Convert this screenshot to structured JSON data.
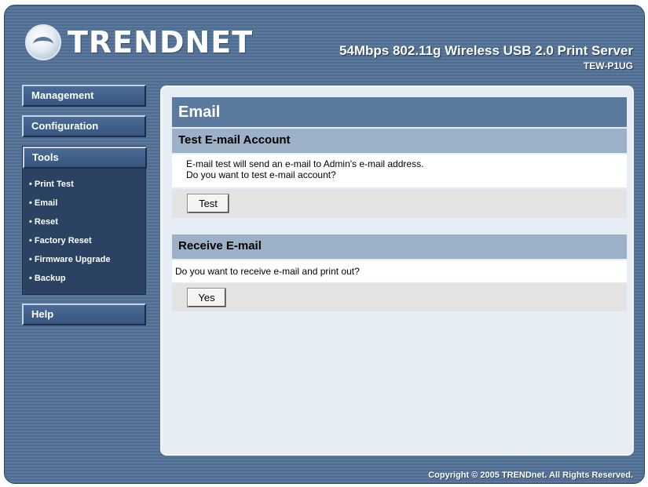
{
  "header": {
    "logo_text": "TRENDNET",
    "product_title": "54Mbps 802.11g Wireless USB 2.0 Print Server",
    "product_model": "TEW-P1UG"
  },
  "sidebar": {
    "management": "Management",
    "configuration": "Configuration",
    "tools": "Tools",
    "tools_items": [
      "• Print Test",
      "• Email",
      "• Reset",
      "• Factory Reset",
      "• Firmware Upgrade",
      "• Backup"
    ],
    "help": "Help"
  },
  "main": {
    "title": "Email",
    "test_section": {
      "header": "Test E-mail Account",
      "line1": "E-mail test will send an e-mail to Admin's e-mail address.",
      "line2": "Do you want to test e-mail account?",
      "button": "Test"
    },
    "receive_section": {
      "header": "Receive E-mail",
      "line1": "Do you want to receive e-mail and print out?",
      "button": "Yes"
    }
  },
  "footer": {
    "copyright": "Copyright © 2005 TRENDnet. All Rights Reserved."
  },
  "colors": {
    "frame_blue": "#5a789b",
    "section_title": "#5a7aa0",
    "sub_header": "#9cb0c7",
    "nav_dark": "#2b4263"
  }
}
